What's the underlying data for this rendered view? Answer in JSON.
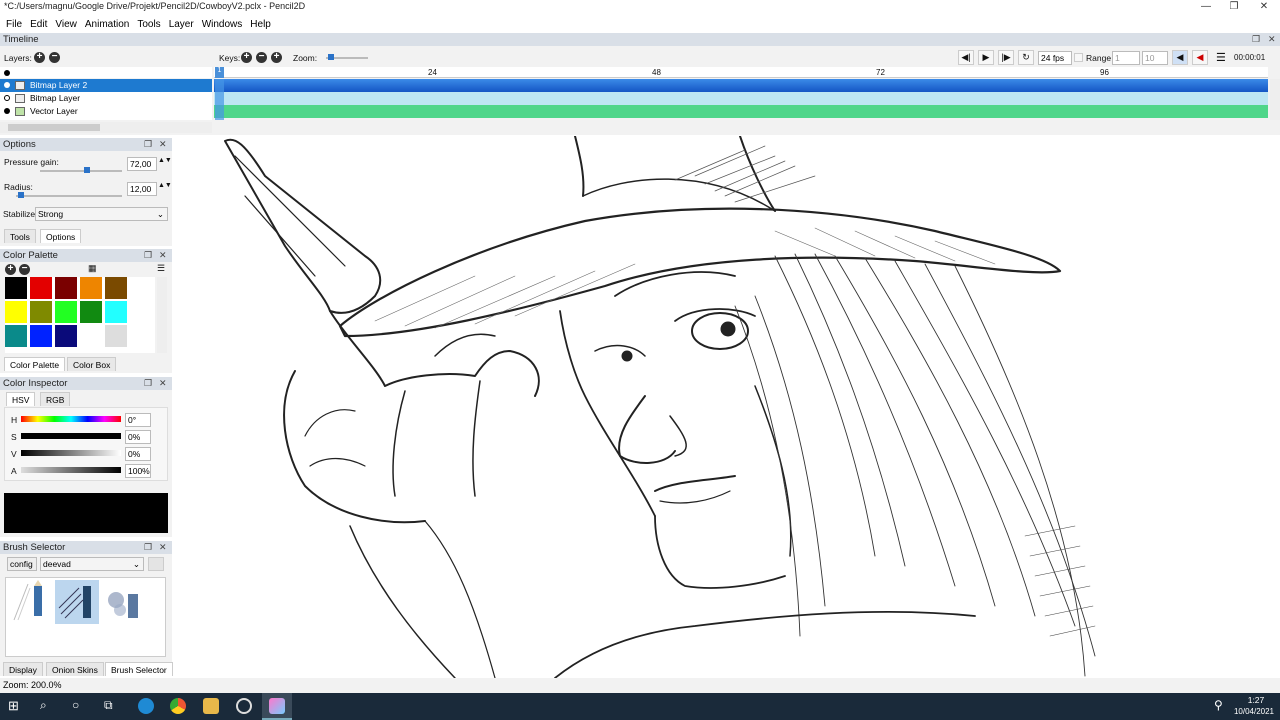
{
  "window": {
    "title": "*C:/Users/magnu/Google Drive/Projekt/Pencil2D/CowboyV2.pclx - Pencil2D"
  },
  "menu": [
    "File",
    "Edit",
    "View",
    "Animation",
    "Tools",
    "Layer",
    "Windows",
    "Help"
  ],
  "timeline": {
    "title": "Timeline",
    "layers_label": "Layers:",
    "keys_label": "Keys:",
    "zoom_label": "Zoom:",
    "ruler_ticks": [
      "24",
      "48",
      "72",
      "96"
    ],
    "fps": "24 fps",
    "range_label": "Range",
    "range_start": "1",
    "range_end": "10",
    "time": "00:00:01",
    "current_frame": "1",
    "layers": [
      {
        "name": "Bitmap Layer 2",
        "selected": true,
        "color": "#1f6fd6"
      },
      {
        "name": "Bitmap Layer",
        "selected": false,
        "color": "#b8e6f4"
      },
      {
        "name": "Vector Layer",
        "selected": false,
        "color": "#4fd88a"
      }
    ]
  },
  "options": {
    "title": "Options",
    "pressure_label": "Pressure gain:",
    "pressure_value": "72,00",
    "radius_label": "Radius:",
    "radius_value": "12,00",
    "stabilizer_label": "Stabilizer",
    "stabilizer_value": "Strong",
    "tabs": [
      "Tools",
      "Options"
    ]
  },
  "palette": {
    "title": "Color Palette",
    "colors": [
      "#000000",
      "#e30000",
      "#7a0000",
      "#ee8500",
      "#7a4a00",
      "#ffff00",
      "#7f8a00",
      "#22ff22",
      "#118a11",
      "#22ffff",
      "#0a8a8a",
      "#0022ff",
      "#0a0a7a",
      "#ffffff",
      "#dddddd"
    ],
    "tabs": [
      "Color Palette",
      "Color Box"
    ]
  },
  "inspector": {
    "title": "Color Inspector",
    "tabs": [
      "HSV",
      "RGB"
    ],
    "rows": [
      {
        "label": "H",
        "value": "0°"
      },
      {
        "label": "S",
        "value": "0%"
      },
      {
        "label": "V",
        "value": "0%"
      },
      {
        "label": "A",
        "value": "100%"
      }
    ],
    "current_color": "#000000"
  },
  "brush": {
    "title": "Brush Selector",
    "config_label": "config",
    "preset": "deevad",
    "bottom_tabs": [
      "Display",
      "Onion Skins",
      "Brush Selector"
    ]
  },
  "status": {
    "zoom": "Zoom: 200.0%"
  },
  "taskbar": {
    "time": "1:27",
    "date": "10/04/2021"
  }
}
